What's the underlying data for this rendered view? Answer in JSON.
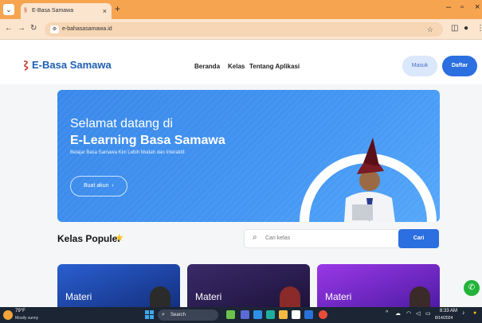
{
  "browser": {
    "tab_title": "E-Basa Samawa",
    "url": "e-bahasasamawa.id",
    "colors": {
      "chrome": "#f7a451",
      "toolbar": "#fbe5cf"
    }
  },
  "site": {
    "logo_text": "E-Basa Samawa",
    "nav": [
      "Beranda",
      "Kelas",
      "Tentang Aplikasi"
    ],
    "login_label": "Masuk",
    "register_label": "Daftar",
    "colors": {
      "brand": "#1e5fb4",
      "primary": "#2b6fe0",
      "hero": "#4396f2"
    }
  },
  "hero": {
    "line1": "Selamat datang di",
    "line2": "E-Learning Basa Samawa",
    "tagline": "Belajar Basa Samawa Kini Lebih Mudah dan Interaktif.",
    "cta_label": "Buat akun",
    "cta_icon": "chevron-right-icon"
  },
  "popular": {
    "title": "Kelas Populer",
    "search_placeholder": "Cari kelas",
    "search_button": "Cari",
    "cards": [
      {
        "label": "Materi",
        "color": "#1d4fb0"
      },
      {
        "label": "Materi",
        "color": "#4a2a8a"
      },
      {
        "label": "Materi",
        "color": "#7a2ed0"
      }
    ]
  },
  "taskbar": {
    "temperature": "79°F",
    "weather": "Mostly sunny",
    "search_label": "Search",
    "time": "8:33 AM",
    "date": "8/14/2024"
  }
}
